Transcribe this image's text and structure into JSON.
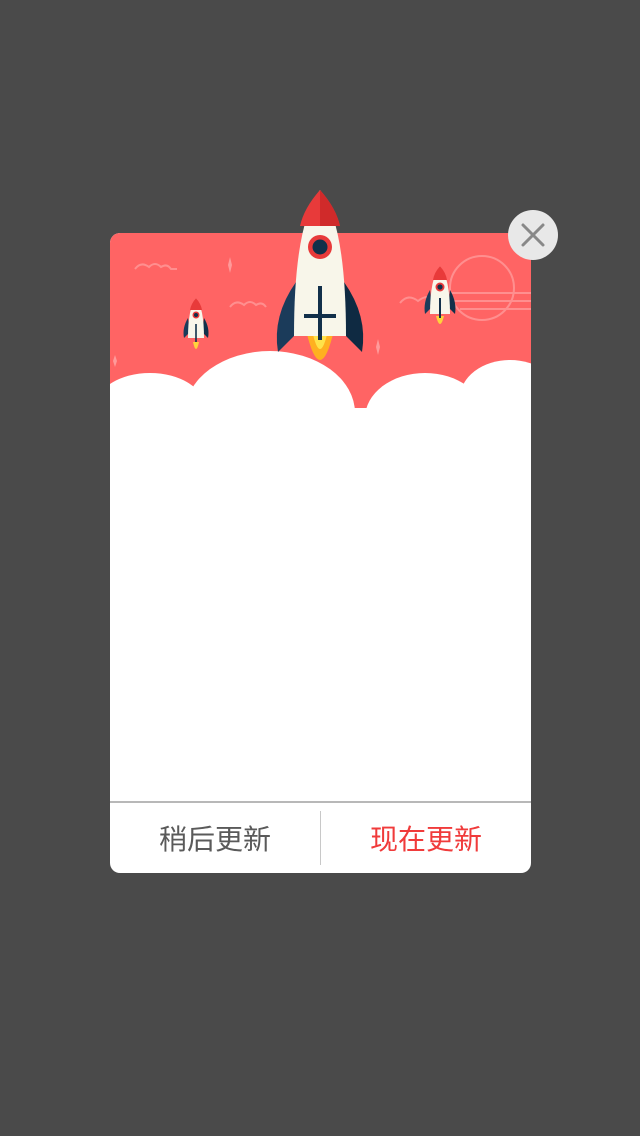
{
  "dialog": {
    "later_label": "稍后更新",
    "now_label": "现在更新"
  },
  "colors": {
    "overlay": "#4a4a4a",
    "banner": "#ff6464",
    "accent": "#f03b3b",
    "secondary_text": "#5a5a5a"
  },
  "icons": {
    "close": "close-icon",
    "rocket": "rocket-icon"
  }
}
